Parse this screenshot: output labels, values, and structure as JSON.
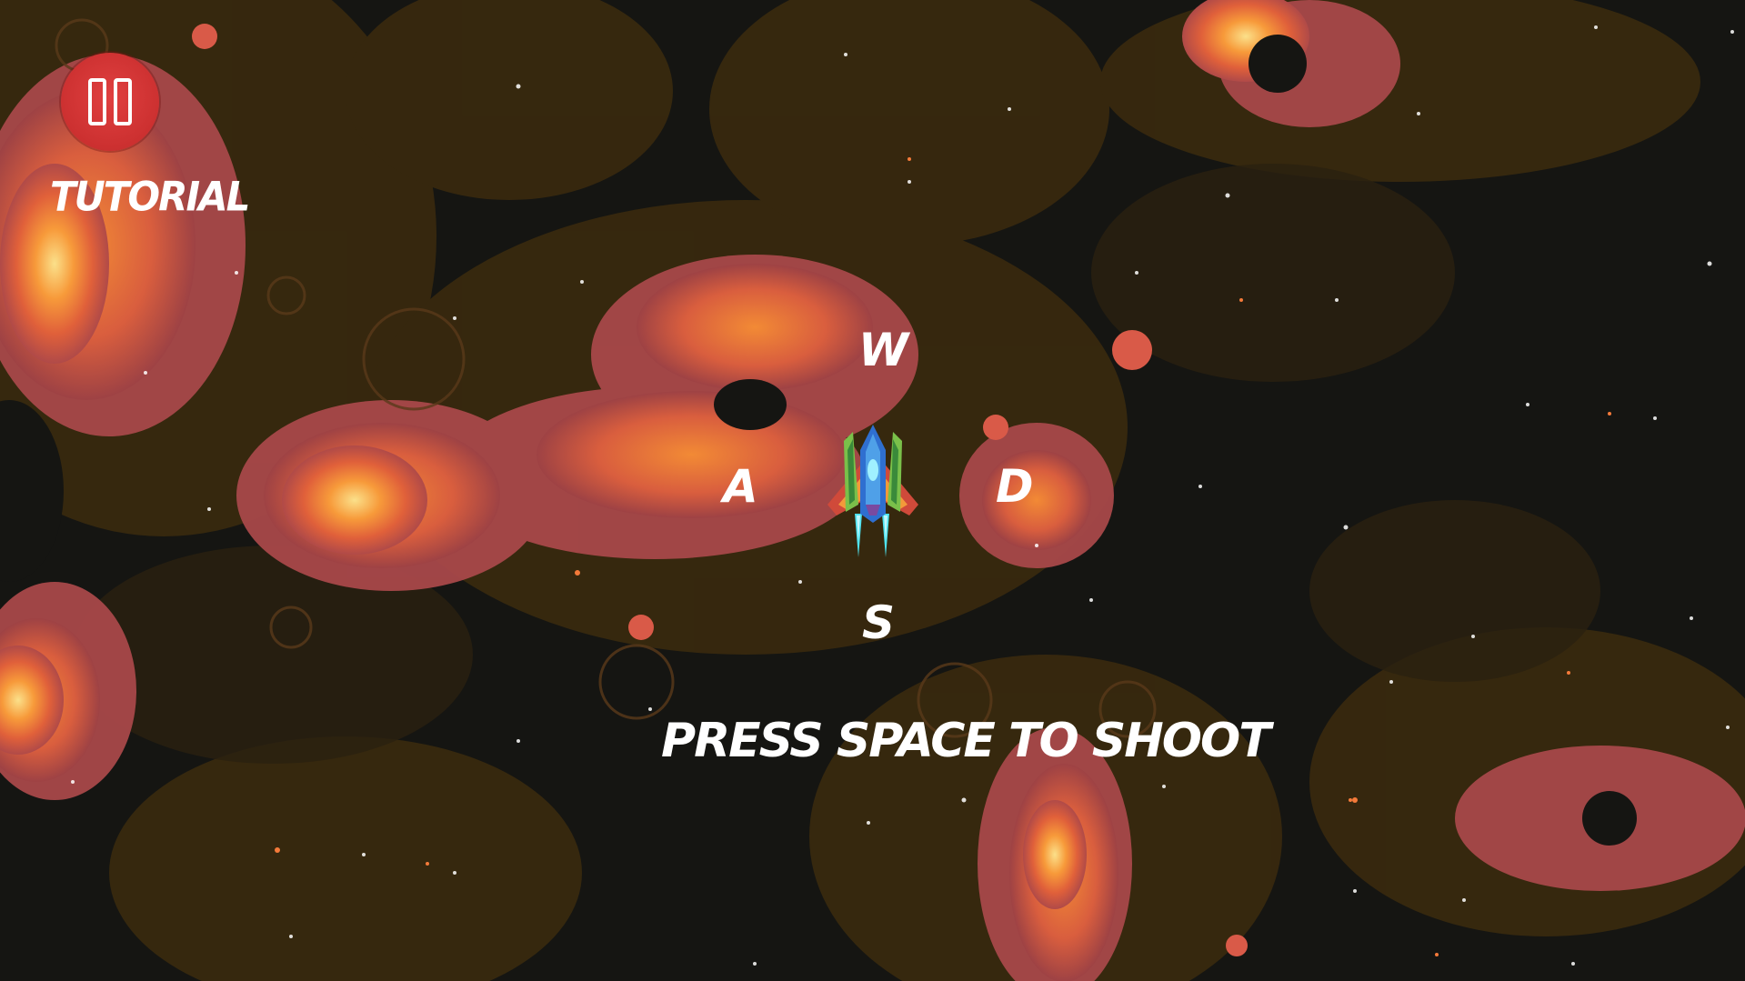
{
  "hud": {
    "pause_icon": "pause-icon",
    "tutorial_label": "TUTORIAL"
  },
  "controls": {
    "up": "W",
    "left": "A",
    "right": "D",
    "down": "S",
    "shoot_hint": "PRESS SPACE TO SHOOT"
  },
  "colors": {
    "background": "#151512",
    "nebula_dark": "#3a2a0e",
    "nebula_red": "#b04a48",
    "nebula_orange": "#f07a2a",
    "nebula_yellow": "#f8d27a",
    "pause_button": "#d63a3a",
    "text": "#ffffff"
  }
}
